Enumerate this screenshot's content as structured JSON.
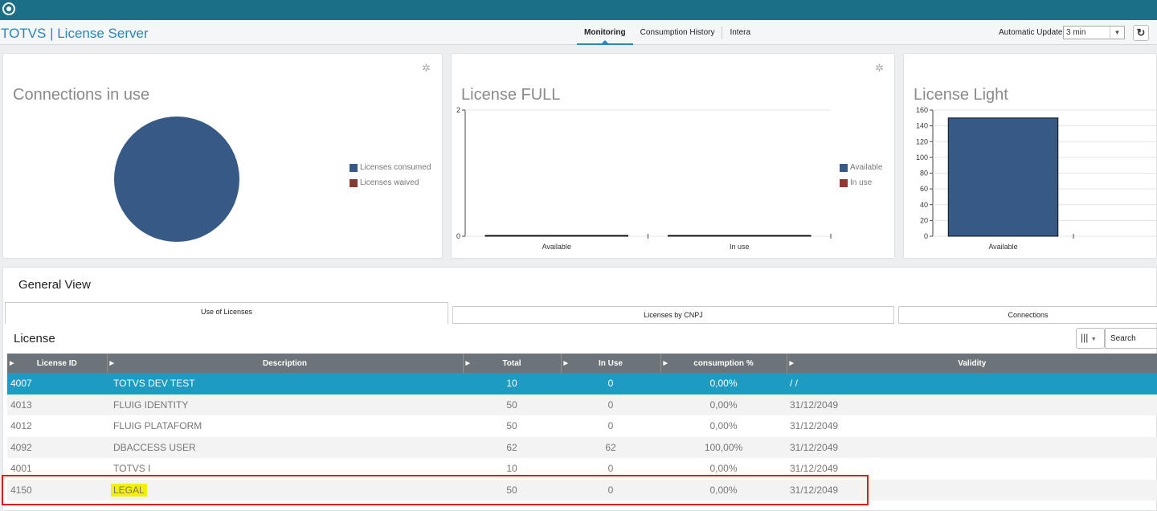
{
  "app": {
    "title": "TOTVS | License Server"
  },
  "nav": {
    "tabs": [
      "Monitoring",
      "Consumption History",
      "Intera"
    ],
    "active": "Monitoring"
  },
  "auto_update": {
    "label": "Automatic Update",
    "value": "3 min"
  },
  "cards": {
    "connections": {
      "title": "Connections in use",
      "legend": [
        "Licenses consumed",
        "Licenses waived"
      ]
    },
    "full": {
      "title": "License FULL",
      "legend": [
        "Available",
        "In use"
      ]
    },
    "light": {
      "title": "License Light"
    }
  },
  "colors": {
    "consumed": "#365a85",
    "waived": "#8b3a32",
    "accent": "#2a85bd",
    "selected_row": "#1e9bc0",
    "highlight": "#f4f000",
    "outline": "#e0161b"
  },
  "chart_data": [
    {
      "type": "pie",
      "title": "Connections in use",
      "labels": [
        "Licenses consumed",
        "Licenses waived"
      ],
      "values": [
        100,
        0
      ]
    },
    {
      "type": "bar",
      "title": "License FULL",
      "categories": [
        "Available",
        "In use"
      ],
      "series": [
        {
          "name": "Available",
          "values": [
            0,
            0
          ]
        },
        {
          "name": "In use",
          "values": [
            0,
            0
          ]
        }
      ],
      "ylim": [
        0,
        2
      ],
      "yticks": [
        "0",
        "2"
      ]
    },
    {
      "type": "bar",
      "title": "License Light",
      "categories": [
        "Available"
      ],
      "values": [
        150
      ],
      "ylim": [
        0,
        160
      ],
      "yticks": [
        "0",
        "20",
        "40",
        "60",
        "80",
        "100",
        "120",
        "140",
        "160"
      ]
    }
  ],
  "general": {
    "title": "General View",
    "tabs": [
      "Use of Licenses",
      "Licenses by CNPJ",
      "Connections"
    ],
    "section_title": "License",
    "search_placeholder": "Search",
    "columns": [
      "License ID",
      "Description",
      "Total",
      "In Use",
      "consumption %",
      "Validity"
    ],
    "rows": [
      {
        "id": "4007",
        "description": "TOTVS DEV TEST",
        "total": "10",
        "in_use": "0",
        "consumption": "0,00%",
        "validity": " / /"
      },
      {
        "id": "4013",
        "description": "FLUIG IDENTITY",
        "total": "50",
        "in_use": "0",
        "consumption": "0,00%",
        "validity": "31/12/2049"
      },
      {
        "id": "4012",
        "description": "FLUIG PLATAFORM",
        "total": "50",
        "in_use": "0",
        "consumption": "0,00%",
        "validity": "31/12/2049"
      },
      {
        "id": "4092",
        "description": "DBACCESS USER",
        "total": "62",
        "in_use": "62",
        "consumption": "100,00%",
        "validity": "31/12/2049"
      },
      {
        "id": "4001",
        "description": "TOTVS I",
        "total": "10",
        "in_use": "0",
        "consumption": "0,00%",
        "validity": "31/12/2049"
      },
      {
        "id": "4150",
        "description": "LEGAL",
        "total": "50",
        "in_use": "0",
        "consumption": "0,00%",
        "validity": "31/12/2049"
      }
    ]
  }
}
